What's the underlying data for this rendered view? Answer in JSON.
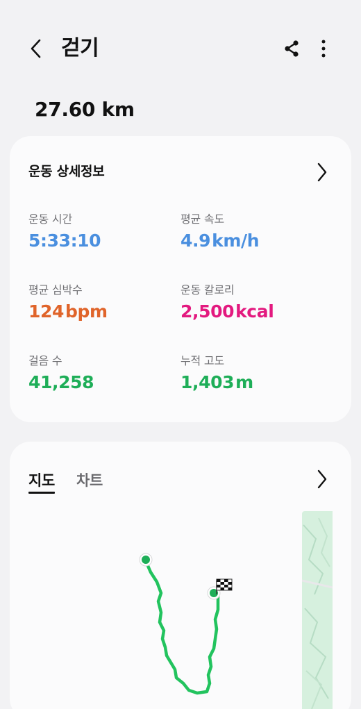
{
  "header": {
    "title": "걷기",
    "distance": "27.60 km"
  },
  "details": {
    "title": "운동 상세정보",
    "metrics": [
      {
        "label": "운동 시간",
        "value": "5:33:10",
        "unit": ""
      },
      {
        "label": "평균 속도",
        "value": "4.9",
        "unit": "km/h"
      },
      {
        "label": "평균 심박수",
        "value": "124",
        "unit": "bpm"
      },
      {
        "label": "운동 칼로리",
        "value": "2,500",
        "unit": "kcal"
      },
      {
        "label": "걸음 수",
        "value": "41,258",
        "unit": ""
      },
      {
        "label": "누적 고도",
        "value": "1,403",
        "unit": "m"
      }
    ]
  },
  "map_card": {
    "tabs": [
      {
        "label": "지도",
        "selected": true
      },
      {
        "label": "차트",
        "selected": false
      }
    ]
  },
  "icons": {
    "back": "chevron-left-icon",
    "share": "share-icon",
    "more": "more-vertical-icon",
    "details_more": "chevron-right-icon",
    "map_more": "chevron-right-icon",
    "start": "start-point-icon",
    "finish": "checkered-flag-icon"
  },
  "colors": {
    "background": "#f2f2f4",
    "card": "#fbfbfc",
    "blue": "#4a8fdf",
    "orange": "#e0642a",
    "pink": "#e3197f",
    "green": "#1eae58",
    "route": "#22c35e",
    "map_strip": "#d6f0de"
  }
}
